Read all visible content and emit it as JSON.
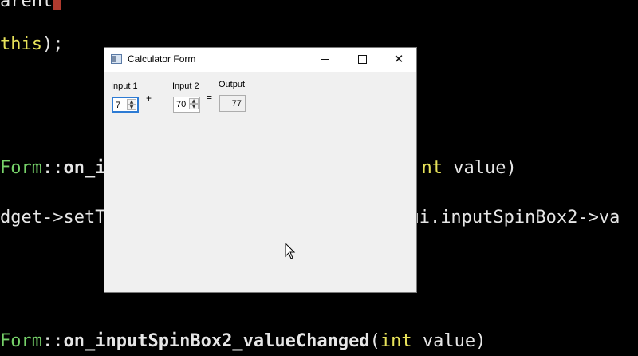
{
  "background_code": {
    "line1": {
      "text": "arent",
      "cursor": true
    },
    "line2": {
      "a": "this",
      "b": ");"
    },
    "line3": {
      "a": "Form",
      "b": "::",
      "c": "on_i",
      "d": "nt",
      "e": " value)"
    },
    "line4": {
      "a": "dget->setT",
      "b": "ui.inputSpinBox2->va"
    },
    "line5": {
      "a": "Form",
      "b": "::",
      "c": "on_inputSpinBox2_valueChanged",
      "d": "(",
      "e": "int",
      "f": " value)"
    }
  },
  "window": {
    "title": "Calculator Form",
    "controls": {
      "minimize": "",
      "maximize": "",
      "close": "✕"
    }
  },
  "form": {
    "input1": {
      "label": "Input 1",
      "value": "7"
    },
    "plus": "+",
    "input2": {
      "label": "Input 2",
      "value": "70"
    },
    "equals": "=",
    "output": {
      "label": "Output",
      "value": "77"
    },
    "spin_up": "▲",
    "spin_down": "▼"
  },
  "colors": {
    "code_yellow": "#e8e35a",
    "code_green": "#77d36a",
    "focus_blue": "#2d7bd4"
  }
}
